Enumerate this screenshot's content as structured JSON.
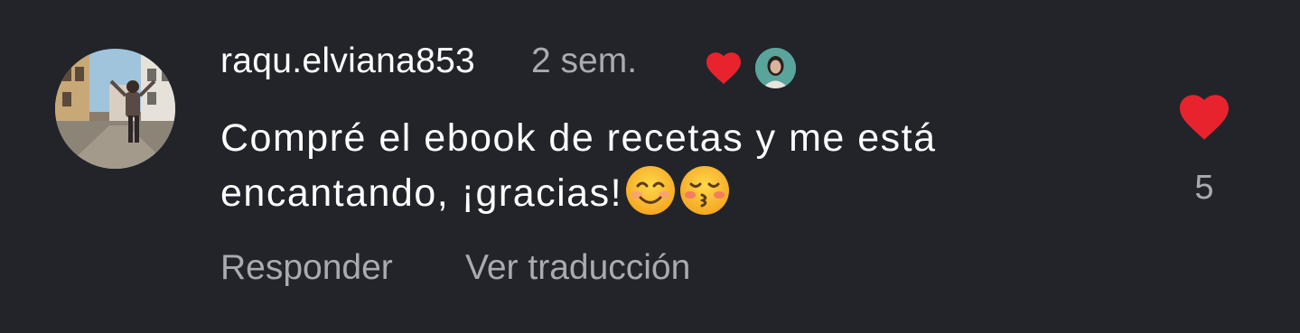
{
  "comment": {
    "username": "raqu.elviana853",
    "time": "2 sem.",
    "text": "Compré el ebook de recetas y me está encantando, ¡gracias!",
    "emojis": [
      "smiling-face-emoji",
      "kissing-face-emoji"
    ],
    "creator_liked_icon": "heart-icon",
    "actions": {
      "reply_label": "Responder",
      "translate_label": "Ver traducción"
    },
    "likes": {
      "icon": "heart-icon",
      "count": "5",
      "color": "#e8232e"
    }
  },
  "colors": {
    "background": "#22242a",
    "primary_text": "#ffffff",
    "secondary_text": "#a8abb1",
    "like_red": "#e8232e"
  }
}
